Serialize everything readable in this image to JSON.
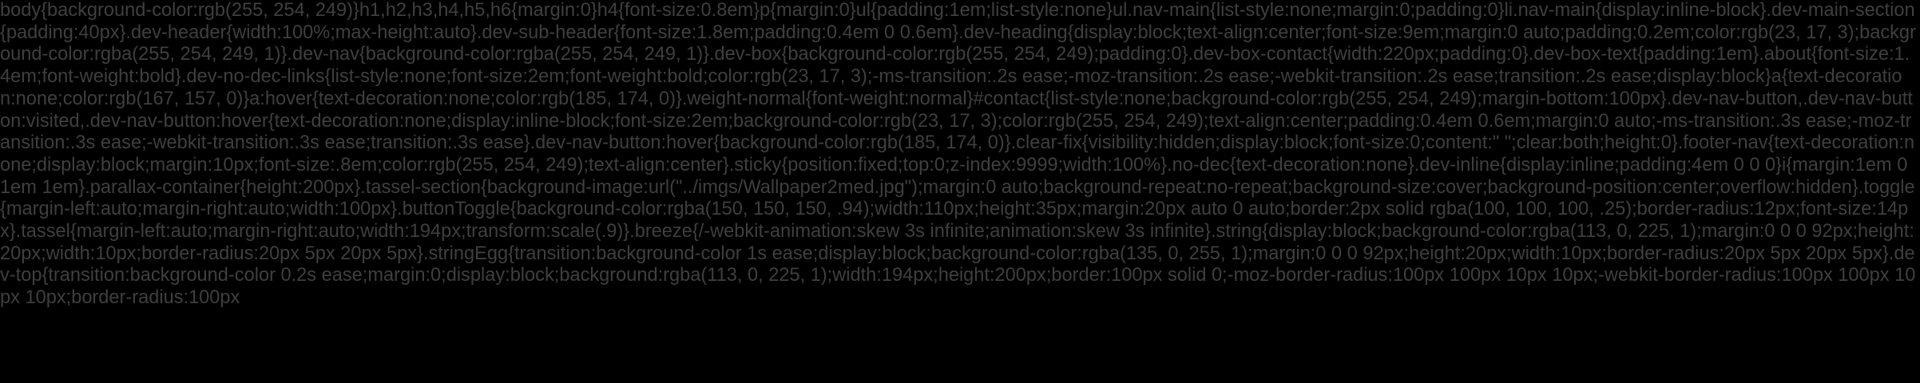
{
  "css_source_text": "body{background-color:rgb(255, 254, 249)}h1,h2,h3,h4,h5,h6{margin:0}h4{font-size:0.8em}p{margin:0}ul{padding:1em;list-style:none}ul.nav-main{list-style:none;margin:0;padding:0}li.nav-main{display:inline-block}.dev-main-section{padding:40px}.dev-header{width:100%;max-height:auto}.dev-sub-header{font-size:1.8em;padding:0.4em 0 0.6em}.dev-heading{display:block;text-align:center;font-size:9em;margin:0 auto;padding:0.2em;color:rgb(23, 17, 3);background-color:rgba(255, 254, 249, 1)}.dev-nav{background-color:rgba(255, 254, 249, 1)}.dev-box{background-color:rgb(255, 254, 249);padding:0}.dev-box-contact{width:220px;padding:0}.dev-box-text{padding:1em}.about{font-size:1.4em;font-weight:bold}.dev-no-dec-links{list-style:none;font-size:2em;font-weight:bold;color:rgb(23, 17, 3);-ms-transition:.2s ease;-moz-transition:.2s ease;-webkit-transition:.2s ease;transition:.2s ease;display:block}a{text-decoration:none;color:rgb(167, 157, 0)}a:hover{text-decoration:none;color:rgb(185, 174, 0)}.weight-normal{font-weight:normal}#contact{list-style:none;background-color:rgb(255, 254, 249);margin-bottom:100px}.dev-nav-button,.dev-nav-button:visited,.dev-nav-button:hover{text-decoration:none;display:inline-block;font-size:2em;background-color:rgb(23, 17, 3);color:rgb(255, 254, 249);text-align:center;padding:0.4em 0.6em;margin:0 auto;-ms-transition:.3s ease;-moz-transition:.3s ease;-webkit-transition:.3s ease;transition:.3s ease}.dev-nav-button:hover{background-color:rgb(185, 174, 0)}.clear-fix{visibility:hidden;display:block;font-size:0;content:\" \";clear:both;height:0}.footer-nav{text-decoration:none;display:block;margin:10px;font-size:.8em;color:rgb(255, 254, 249);text-align:center}.sticky{position:fixed;top:0;z-index:9999;width:100%}.no-dec{text-decoration:none}.dev-inline{display:inline;padding:4em 0 0 0}i{margin:1em 0 1em 1em}.parallax-container{height:200px}.tassel-section{background-image:url(\"../imgs/Wallpaper2med.jpg\");margin:0 auto;background-repeat:no-repeat;background-size:cover;background-position:center;overflow:hidden}.toggle{margin-left:auto;margin-right:auto;width:100px}.buttonToggle{background-color:rgba(150, 150, 150, .94);width:110px;height:35px;margin:20px auto 0 auto;border:2px solid rgba(100, 100, 100, .25);border-radius:12px;font-size:14px}.tassel{margin-left:auto;margin-right:auto;width:194px;transform:scale(.9)}.breeze{/-webkit-animation:skew 3s infinite;animation:skew 3s infinite}.string{display:block;background-color:rgba(113, 0, 225, 1);margin:0 0 0 92px;height:20px;width:10px;border-radius:20px 5px 20px 5px}.stringEgg{transition:background-color 1s ease;display:block;background-color:rgba(135, 0, 255, 1);margin:0 0 0 92px;height:20px;width:10px;border-radius:20px 5px 20px 5px}.dev-top{transition:background-color 0.2s ease;margin:0;display:block;background:rgba(113, 0, 225, 1);width:194px;height:200px;border:100px solid 0;-moz-border-radius:100px 100px 10px 10px;-webkit-border-radius:100px 100px 10px 10px;border-radius:100px",
  "colors": {
    "background": "#000000",
    "text": "#3f3f3f"
  }
}
